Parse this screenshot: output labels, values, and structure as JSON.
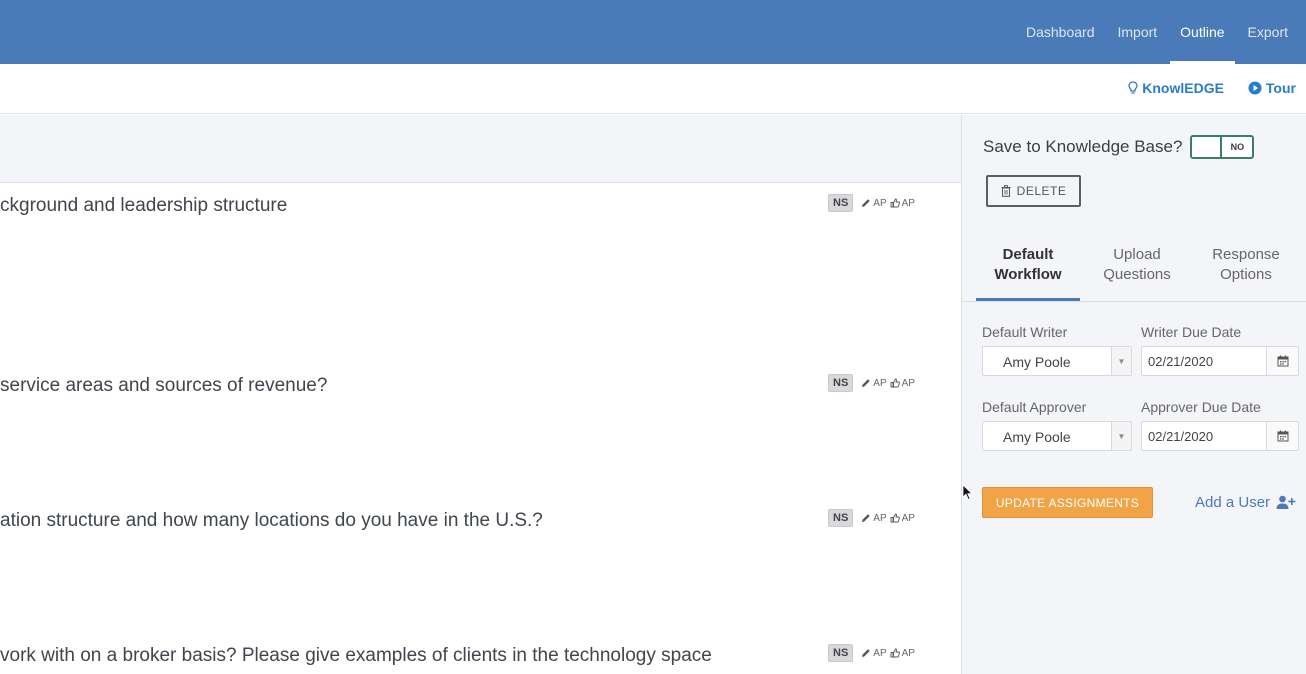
{
  "topnav": {
    "items": [
      {
        "label": "Dashboard"
      },
      {
        "label": "Import"
      },
      {
        "label": "Outline"
      },
      {
        "label": "Export"
      }
    ],
    "active": "Outline"
  },
  "subnav": {
    "knowledge_label": "KnowlEDGE",
    "tour_label": "Tour"
  },
  "questions": [
    {
      "text": "ckground and leadership structure",
      "badge": "NS",
      "writer": "AP",
      "approver": "AP"
    },
    {
      "text": "service areas and sources of revenue?",
      "badge": "NS",
      "writer": "AP",
      "approver": "AP"
    },
    {
      "text": "ation structure and how many locations do you have in the U.S.?",
      "badge": "NS",
      "writer": "AP",
      "approver": "AP"
    },
    {
      "text": "vork with on a broker basis? Please give examples of clients in the technology space",
      "badge": "NS",
      "writer": "AP",
      "approver": "AP"
    }
  ],
  "sidebar": {
    "kb_label": "Save to Knowledge Base?",
    "kb_toggle": "NO",
    "delete_label": "DELETE",
    "tabs": [
      {
        "line1": "Default",
        "line2": "Workflow"
      },
      {
        "line1": "Upload",
        "line2": "Questions"
      },
      {
        "line1": "Response",
        "line2": "Options"
      }
    ],
    "active_tab": "Default Workflow",
    "default_writer_label": "Default Writer",
    "default_writer_value": "Amy Poole",
    "writer_due_label": "Writer Due Date",
    "writer_due_value": "02/21/2020",
    "default_approver_label": "Default Approver",
    "default_approver_value": "Amy Poole",
    "approver_due_label": "Approver Due Date",
    "approver_due_value": "02/21/2020",
    "update_label": "UPDATE ASSIGNMENTS",
    "add_user_label": "Add a User"
  },
  "colors": {
    "header": "#4a7bb8",
    "accent_link": "#2a7cc7",
    "update_button": "#f0a446",
    "toggle_border": "#3b7d6b"
  }
}
